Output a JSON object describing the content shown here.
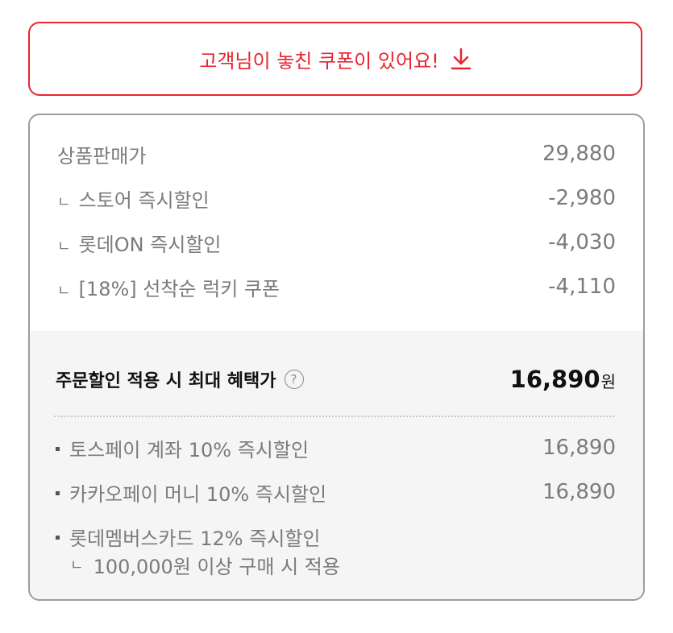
{
  "coupon_banner": {
    "text": "고객님이 놓친 쿠폰이 있어요!",
    "icon": "download-arrow-icon",
    "color": "#e8242f"
  },
  "price_breakdown": {
    "list_price": {
      "label": "상품판매가",
      "amount": "29,880"
    },
    "discounts": [
      {
        "prefix": "ㄴ",
        "label": "스토어 즉시할인",
        "amount": "-2,980"
      },
      {
        "prefix": "ㄴ",
        "label": "롯데ON 즉시할인",
        "amount": "-4,030"
      },
      {
        "prefix": "ㄴ",
        "label": "[18%] 선착순 럭키 쿠폰",
        "amount": "-4,110"
      }
    ]
  },
  "max_benefit": {
    "label": "주문할인 적용 시 최대 혜택가",
    "help_icon": "question-circle-icon",
    "help_glyph": "?",
    "price": "16,890",
    "unit": "원"
  },
  "payment_benefits": [
    {
      "label": "토스페이 계좌 10% 즉시할인",
      "amount": "16,890"
    },
    {
      "label": "카카오페이 머니 10% 즉시할인",
      "amount": "16,890"
    },
    {
      "label": "롯데멤버스카드 12% 즉시할인",
      "amount": ""
    }
  ],
  "payment_benefit_note": {
    "prefix": "ㄴ",
    "text": "100,000원 이상 구매 시 적용"
  }
}
